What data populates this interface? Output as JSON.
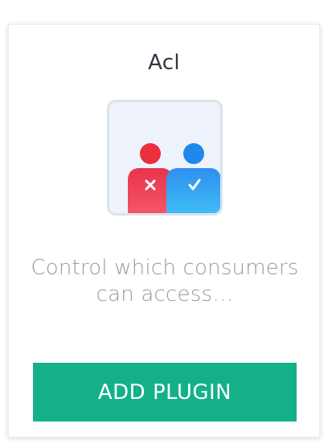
{
  "plugin_card": {
    "title": "Acl",
    "icon": "users-access-control-icon",
    "description": "Control which consumers can access…",
    "action_label": "ADD PLUGIN"
  },
  "colors": {
    "accent": "#14b189",
    "title": "#2b3742",
    "description": "#9a9a9a",
    "denied_user": "#ee3e54",
    "allowed_user": "#2b9cf2",
    "icon_background": "#eef3fb"
  }
}
